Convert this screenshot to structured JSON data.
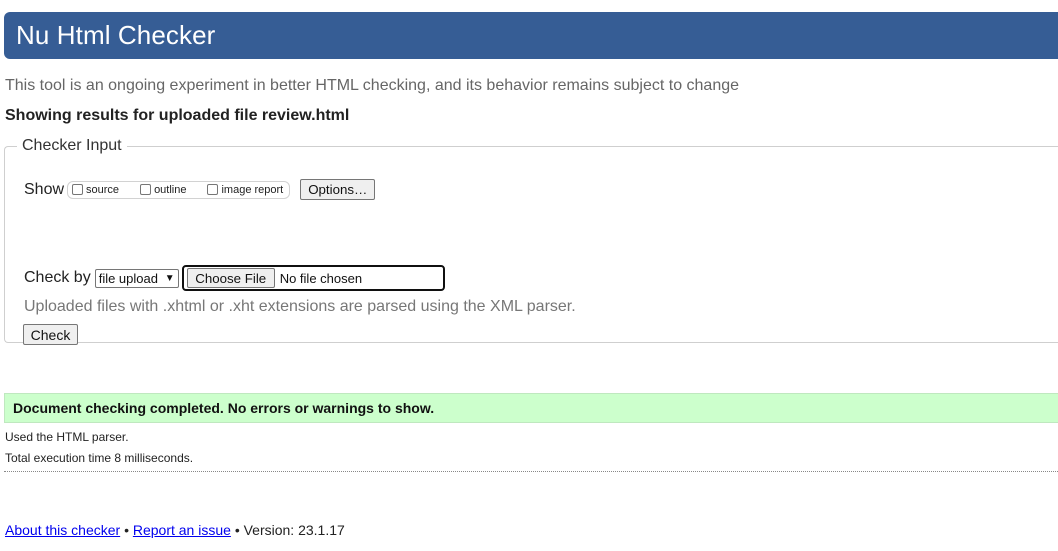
{
  "header": {
    "title": "Nu Html Checker"
  },
  "intro": "This tool is an ongoing experiment in better HTML checking, and its behavior remains subject to change",
  "results_for": "Showing results for uploaded file review.html",
  "checker_input": {
    "legend": "Checker Input",
    "show_label": "Show",
    "show_options": [
      {
        "label": "source",
        "checked": false
      },
      {
        "label": "outline",
        "checked": false
      },
      {
        "label": "image report",
        "checked": false
      }
    ],
    "options_button": "Options…",
    "check_by_label": "Check by",
    "check_by_value": "file upload",
    "choose_file_button": "Choose File",
    "no_file_text": "No file chosen",
    "xml_note": "Uploaded files with .xhtml or .xht extensions are parsed using the XML parser.",
    "check_button": "Check"
  },
  "result": {
    "success_message": "Document checking completed. No errors or warnings to show.",
    "parser_note": "Used the HTML parser.",
    "execution_time": "Total execution time 8 milliseconds."
  },
  "footer": {
    "about_link": "About this checker",
    "report_link": "Report an issue",
    "separator": "•",
    "version_text": "Version: 23.1.17"
  }
}
